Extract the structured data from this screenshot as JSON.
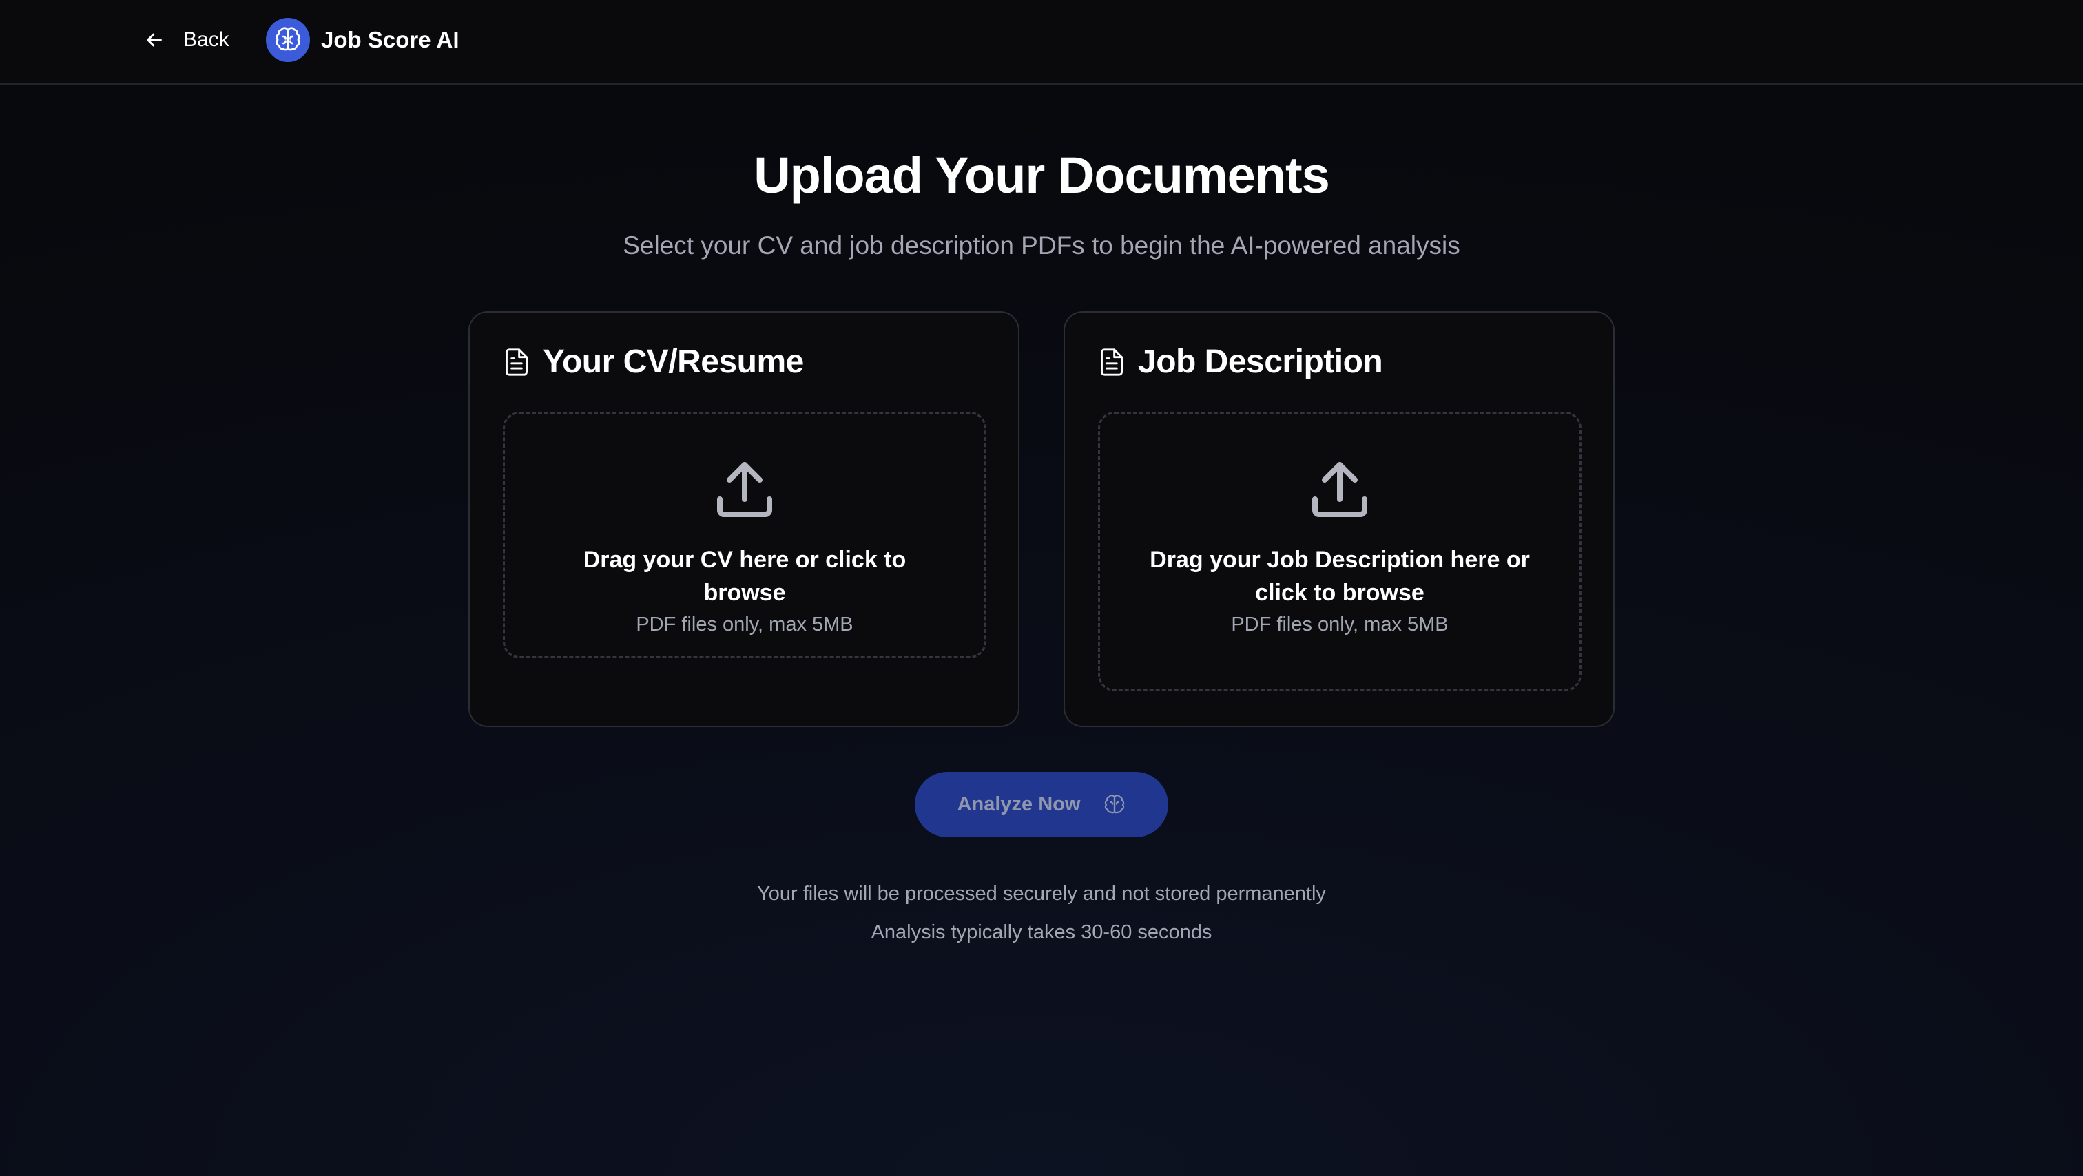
{
  "header": {
    "back_label": "Back",
    "back_icon": "arrow-left-icon",
    "brand_icon": "brain-icon",
    "brand_title": "Job Score AI"
  },
  "main": {
    "title": "Upload Your Documents",
    "subtitle": "Select your CV and job description PDFs to begin the AI-powered analysis"
  },
  "cards": [
    {
      "title": "Your CV/Resume",
      "icon": "document-icon",
      "dropzone_icon": "upload-icon",
      "dropzone_text": "Drag your CV here or click to browse",
      "dropzone_hint": "PDF files only, max 5MB"
    },
    {
      "title": "Job Description",
      "icon": "document-icon",
      "dropzone_icon": "upload-icon",
      "dropzone_text": "Drag your Job Description here or click to browse",
      "dropzone_hint": "PDF files only, max 5MB"
    }
  ],
  "action": {
    "analyze_label": "Analyze Now",
    "analyze_icon": "brain-icon"
  },
  "footer_notes": {
    "security": "Your files will be processed securely and not stored permanently",
    "timing": "Analysis typically takes 30-60 seconds"
  },
  "colors": {
    "background": "#08090d",
    "accent": "#3b5bdb",
    "button_disabled_bg": "#21368f",
    "muted_text": "#a2a7b3",
    "card_border": "#2b2d34"
  }
}
